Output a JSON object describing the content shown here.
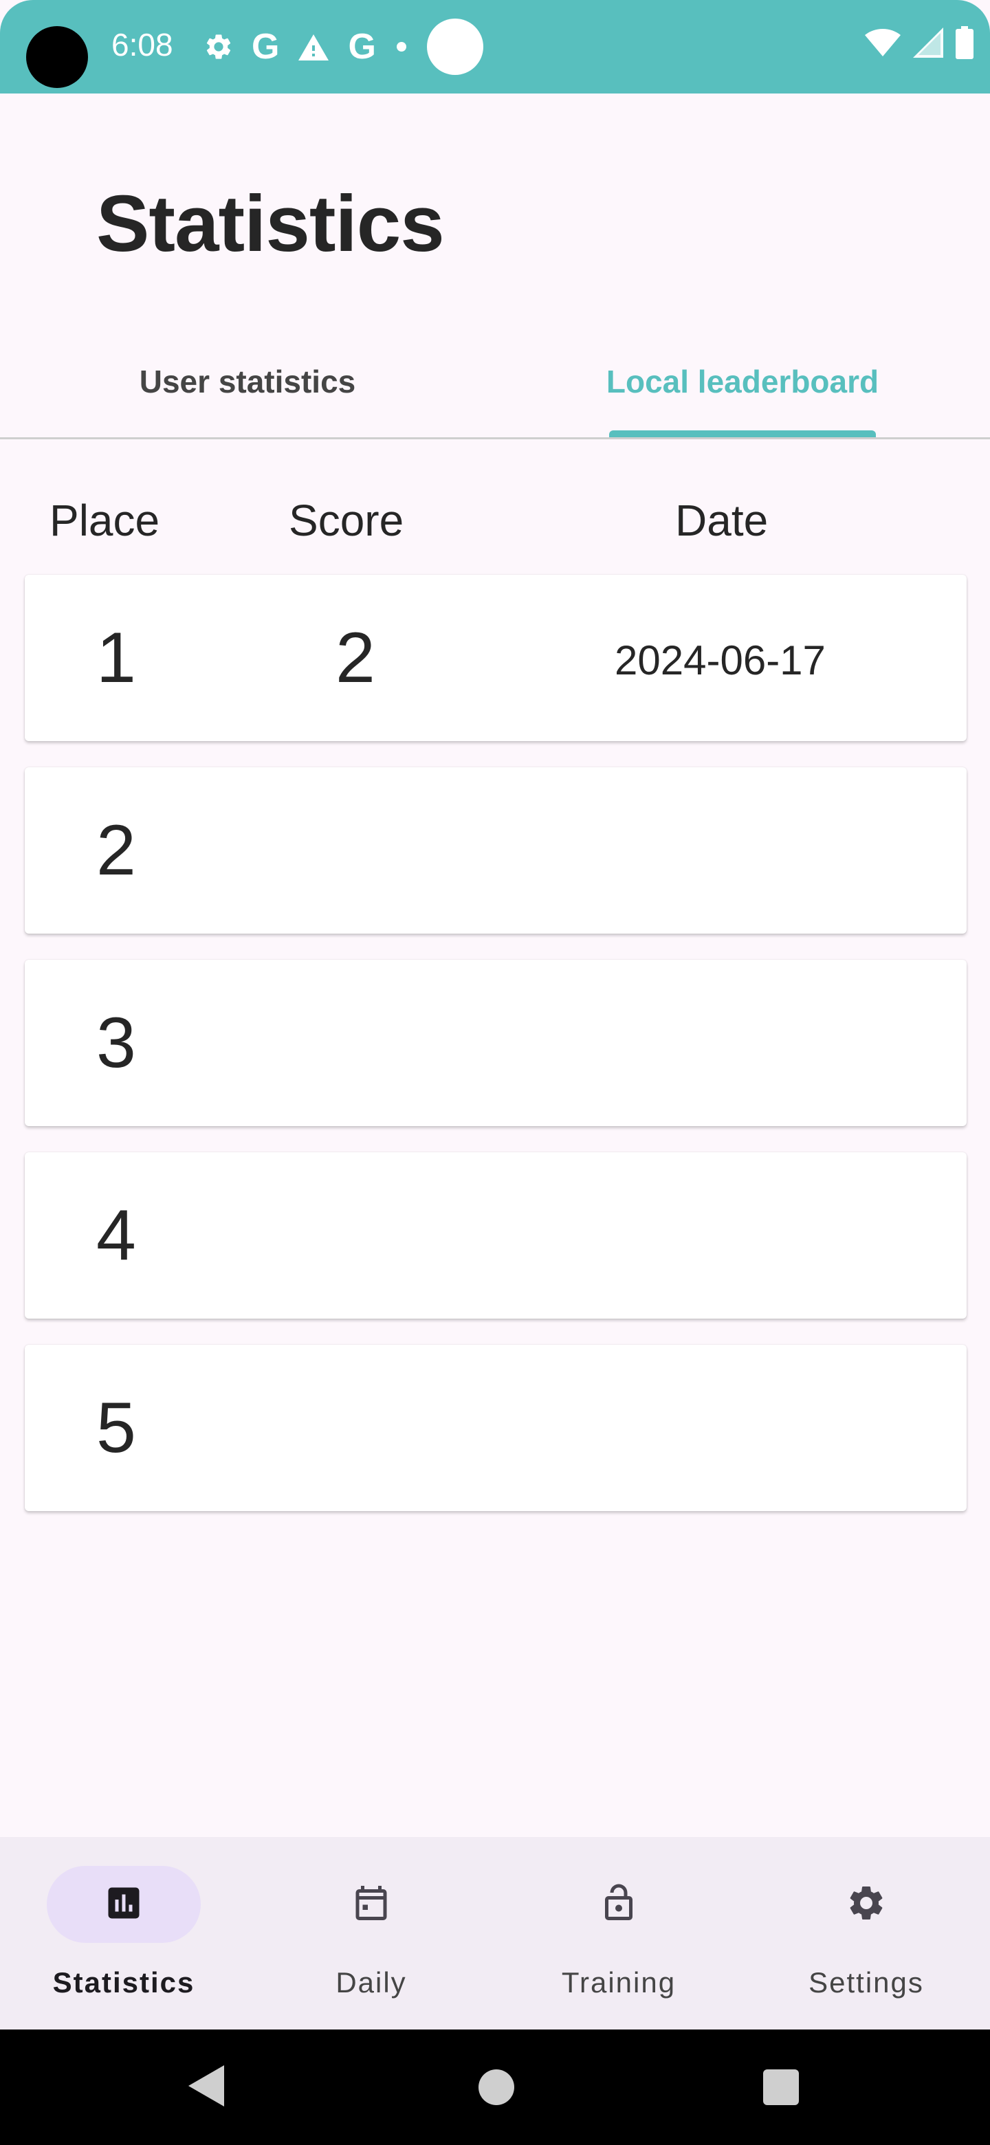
{
  "status_bar": {
    "time": "6:08",
    "icons": [
      "settings-icon",
      "google-g-icon",
      "warning-icon",
      "google-g-icon",
      "dot-icon",
      "circle-icon"
    ],
    "right_icons": [
      "wifi-icon",
      "signal-icon",
      "battery-icon"
    ],
    "background": "#58BFBE"
  },
  "header": {
    "title": "Statistics"
  },
  "tabs": [
    {
      "label": "User statistics",
      "active": false
    },
    {
      "label": "Local leaderboard",
      "active": true
    }
  ],
  "table": {
    "headers": {
      "place": "Place",
      "score": "Score",
      "date": "Date"
    },
    "rows": [
      {
        "place": "1",
        "score": "2",
        "date": "2024-06-17"
      },
      {
        "place": "2",
        "score": "",
        "date": ""
      },
      {
        "place": "3",
        "score": "",
        "date": ""
      },
      {
        "place": "4",
        "score": "",
        "date": ""
      },
      {
        "place": "5",
        "score": "",
        "date": ""
      }
    ]
  },
  "bottom_nav": {
    "items": [
      {
        "label": "Statistics",
        "icon": "bar-chart-icon",
        "active": true
      },
      {
        "label": "Daily",
        "icon": "calendar-icon",
        "active": false
      },
      {
        "label": "Training",
        "icon": "lock-icon",
        "active": false
      },
      {
        "label": "Settings",
        "icon": "gear-icon",
        "active": false
      }
    ]
  },
  "colors": {
    "accent": "#58BFBE",
    "background": "#FDF7FC",
    "nav_background": "#F2ECF4",
    "nav_active_pill": "#E8DEF8"
  }
}
